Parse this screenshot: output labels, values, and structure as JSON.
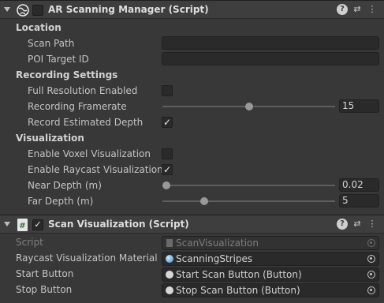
{
  "component1": {
    "title": "AR Scanning Manager (Script)",
    "help_glyph": "?",
    "settings_glyph": "⇄",
    "menu_glyph": "⋮",
    "sections": {
      "location": "Location",
      "recording": "Recording Settings",
      "visualization": "Visualization"
    },
    "fields": {
      "scan_path": {
        "label": "Scan Path",
        "value": ""
      },
      "poi_target_id": {
        "label": "POI Target ID",
        "value": ""
      },
      "full_resolution": {
        "label": "Full Resolution Enabled",
        "checked": false
      },
      "recording_framerate": {
        "label": "Recording Framerate",
        "value": "15",
        "fraction": 0.5
      },
      "record_depth": {
        "label": "Record Estimated Depth",
        "checked": true
      },
      "voxel_vis": {
        "label": "Enable Voxel Visualization",
        "checked": false
      },
      "raycast_vis": {
        "label": "Enable Raycast Visualization",
        "checked": true
      },
      "near_depth": {
        "label": "Near Depth (m)",
        "value": "0.02",
        "fraction": 0.0
      },
      "far_depth": {
        "label": "Far Depth (m)",
        "value": "5",
        "fraction": 0.23
      }
    }
  },
  "component2": {
    "title": "Scan Visualization (Script)",
    "help_glyph": "?",
    "settings_glyph": "⇄",
    "menu_glyph": "⋮",
    "fields": {
      "script": {
        "label": "Script",
        "value": "ScanVisualization"
      },
      "raycast_material": {
        "label": "Raycast Visualization Material",
        "value": "ScanningStripes"
      },
      "start_button": {
        "label": "Start Button",
        "value": "Start Scan Button (Button)"
      },
      "stop_button": {
        "label": "Stop Button",
        "value": "Stop Scan Button (Button)"
      }
    }
  },
  "check_glyph": "✓",
  "colors": {
    "background": "#383838",
    "header": "#3e3e3e",
    "field": "#2a2a2a",
    "text": "#c4c4c4"
  }
}
